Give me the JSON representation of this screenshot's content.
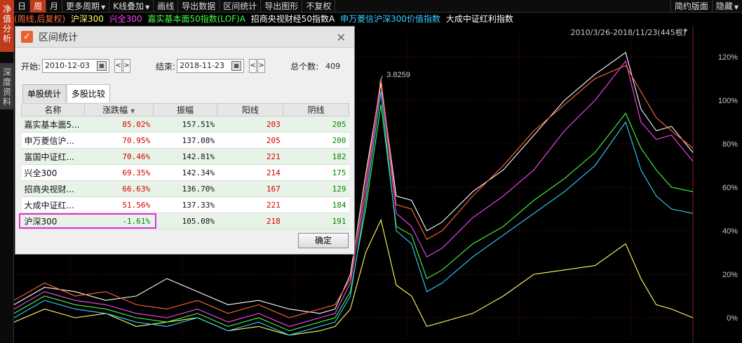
{
  "left_tabs": [
    "净值分析",
    "深度资料"
  ],
  "toolbar": {
    "items": [
      "日",
      "周",
      "月",
      "更多周期",
      "K线叠加",
      "画线",
      "导出数据",
      "区间统计",
      "导出图形",
      "不复权"
    ],
    "active": "周",
    "right": [
      "简约版面",
      "隐藏"
    ]
  },
  "legend": [
    {
      "text": "(周线,后复权)",
      "color": "#ff6a3a"
    },
    {
      "text": "沪深300",
      "color": "#ffff66"
    },
    {
      "text": "兴全300",
      "color": "#ff44ff"
    },
    {
      "text": "嘉实基本面50指数(LOF)A",
      "color": "#44ff44"
    },
    {
      "text": "招商央视财经50指数A",
      "color": "#ffffff"
    },
    {
      "text": "申万菱信沪深300价值指数",
      "color": "#33d4ff"
    },
    {
      "text": "大成中证红利指数",
      "color": "#ffffff"
    }
  ],
  "range_label": "2010/3/26-2018/11/23(445根)",
  "annotation": "3.8259",
  "dialog": {
    "title": "区间统计",
    "start_label": "开始:",
    "start_date": "2010-12-03",
    "end_label": "结束:",
    "end_date": "2018-11-23",
    "total_label": "总个数:",
    "total_value": "409",
    "tabs": [
      "单股统计",
      "多股比较"
    ],
    "active_tab": "多股比较",
    "columns": [
      "名称",
      "涨跌幅",
      "振幅",
      "阳线",
      "阴线"
    ],
    "rows": [
      {
        "name": "嘉实基本面5...",
        "change": "85.02%",
        "amp": "157.51%",
        "up": "203",
        "down": "205"
      },
      {
        "name": "申万菱信沪...",
        "change": "70.95%",
        "amp": "137.08%",
        "up": "205",
        "down": "200"
      },
      {
        "name": "富国中证红...",
        "change": "70.46%",
        "amp": "142.81%",
        "up": "221",
        "down": "182"
      },
      {
        "name": "兴全300",
        "change": "69.35%",
        "amp": "142.34%",
        "up": "214",
        "down": "175"
      },
      {
        "name": "招商央视财...",
        "change": "66.63%",
        "amp": "136.70%",
        "up": "167",
        "down": "129"
      },
      {
        "name": "大成中证红...",
        "change": "51.56%",
        "amp": "137.33%",
        "up": "221",
        "down": "184"
      },
      {
        "name": "沪深300",
        "change": "-1.61%",
        "amp": "105.08%",
        "up": "218",
        "down": "191"
      }
    ],
    "ok_label": "确定"
  },
  "chart_data": {
    "type": "line",
    "ylabel": "",
    "y_ticks": [
      "120%",
      "100%",
      "80%",
      "60%",
      "40%",
      "20%",
      "0%"
    ],
    "ylim": [
      -10,
      130
    ],
    "x": [
      0,
      20,
      40,
      60,
      80,
      100,
      120,
      140,
      160,
      180,
      200,
      210,
      220,
      230,
      240,
      250,
      260,
      270,
      280,
      300,
      320,
      340,
      360,
      380,
      400,
      410,
      420,
      430,
      444
    ],
    "series": [
      {
        "name": "沪深300",
        "color": "#ffff66",
        "values": [
          -2,
          4,
          0,
          2,
          -4,
          -2,
          0,
          -6,
          -4,
          -8,
          -6,
          -4,
          4,
          30,
          45,
          15,
          10,
          -4,
          -2,
          2,
          10,
          20,
          22,
          24,
          34,
          18,
          6,
          4,
          0
        ]
      },
      {
        "name": "兴全300",
        "color": "#ff44ff",
        "values": [
          4,
          12,
          8,
          6,
          2,
          0,
          4,
          -2,
          2,
          -4,
          0,
          2,
          16,
          58,
          108,
          48,
          42,
          28,
          32,
          46,
          56,
          68,
          86,
          100,
          118,
          90,
          82,
          84,
          72
        ]
      },
      {
        "name": "嘉实基本面50指数(LOF)A",
        "color": "#44ff44",
        "values": [
          2,
          10,
          6,
          4,
          0,
          -2,
          2,
          -4,
          0,
          -6,
          -2,
          0,
          12,
          50,
          98,
          42,
          38,
          18,
          22,
          34,
          42,
          54,
          64,
          76,
          94,
          78,
          68,
          60,
          58
        ]
      },
      {
        "name": "招商央视财经50指数A",
        "color": "#ffffff",
        "values": [
          6,
          14,
          12,
          8,
          10,
          18,
          12,
          6,
          8,
          4,
          2,
          4,
          20,
          66,
          108,
          56,
          54,
          40,
          44,
          58,
          68,
          84,
          100,
          112,
          122,
          96,
          86,
          88,
          76
        ]
      },
      {
        "name": "申万菱信沪深300价值指数",
        "color": "#33d4ff",
        "values": [
          0,
          8,
          4,
          2,
          -2,
          -4,
          0,
          -6,
          -2,
          -8,
          -4,
          -2,
          10,
          54,
          104,
          40,
          34,
          12,
          16,
          28,
          38,
          48,
          58,
          70,
          90,
          68,
          56,
          50,
          48
        ]
      },
      {
        "name": "大成中证红利指数",
        "color": "#ff6a3a",
        "values": [
          8,
          16,
          10,
          12,
          6,
          4,
          8,
          2,
          6,
          0,
          4,
          6,
          18,
          62,
          110,
          52,
          50,
          36,
          40,
          56,
          70,
          86,
          98,
          110,
          116,
          104,
          92,
          86,
          78
        ]
      }
    ]
  }
}
